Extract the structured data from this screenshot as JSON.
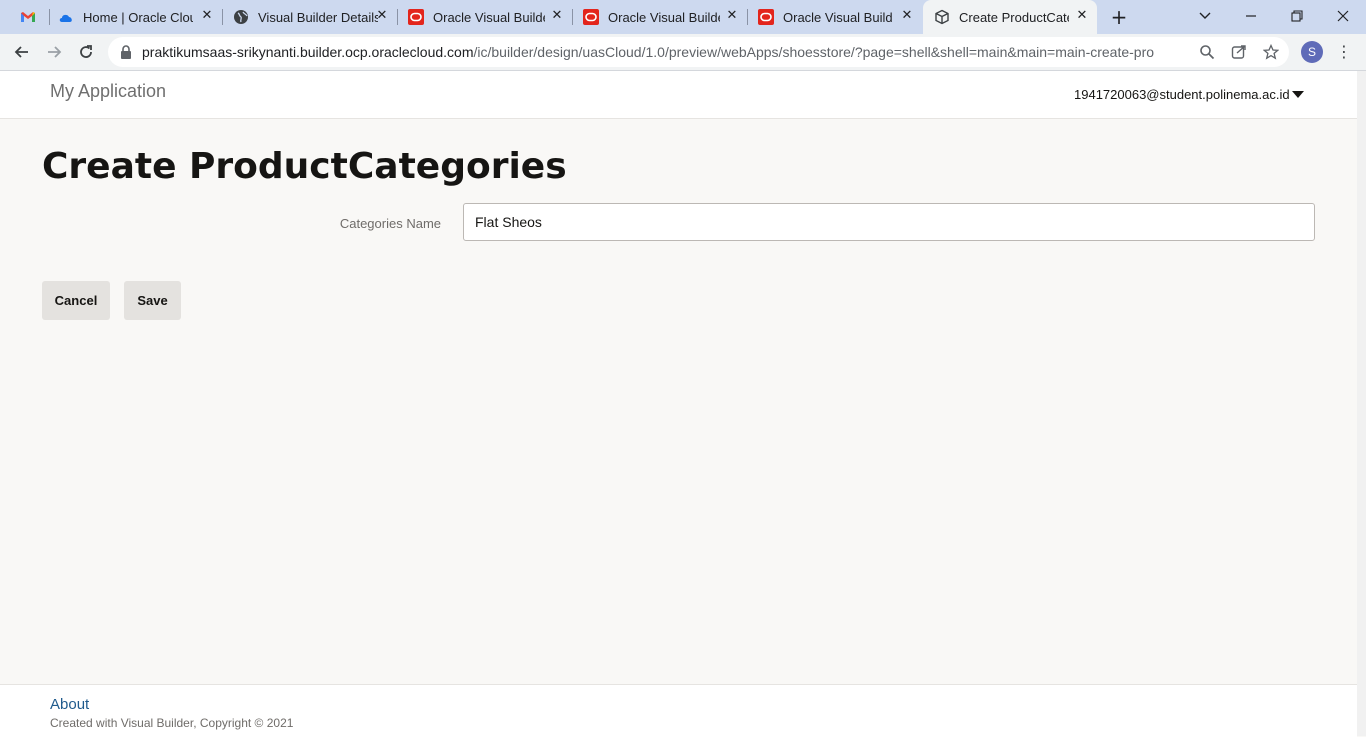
{
  "browser": {
    "tabs": [
      {
        "title": "",
        "icon": "gmail-icon"
      },
      {
        "title": "Home | Oracle Cloud",
        "icon": "cloud-icon"
      },
      {
        "title": "Visual Builder Details",
        "icon": "globe-icon"
      },
      {
        "title": "Oracle Visual Builder",
        "icon": "oracle-icon"
      },
      {
        "title": "Oracle Visual Builder",
        "icon": "oracle-icon"
      },
      {
        "title": "Oracle Visual Builder",
        "icon": "oracle-icon"
      },
      {
        "title": "Create ProductCategories",
        "icon": "cube-icon",
        "active": true
      }
    ],
    "address": {
      "host": "praktikumsaas-srikynanti.builder.ocp.oraclecloud.com",
      "path": "/ic/builder/design/uasCloud/1.0/preview/webApps/shoesstore/?page=shell&shell=main&main=main-create-prod..."
    },
    "profile_initial": "S",
    "colors": {
      "tabstrip": "#cdd9ef",
      "toolbar": "#f1f3f4",
      "profile": "#5f6bb8"
    }
  },
  "app": {
    "title": "My Application",
    "user": "1941720063@student.polinema.ac.id"
  },
  "page": {
    "title": "Create ProductCategories",
    "form": {
      "categories_name_label": "Categories Name",
      "categories_name_value": "Flat Sheos"
    },
    "buttons": {
      "cancel": "Cancel",
      "save": "Save"
    }
  },
  "footer": {
    "about": "About",
    "copyright": "Created with Visual Builder, Copyright © 2021"
  }
}
